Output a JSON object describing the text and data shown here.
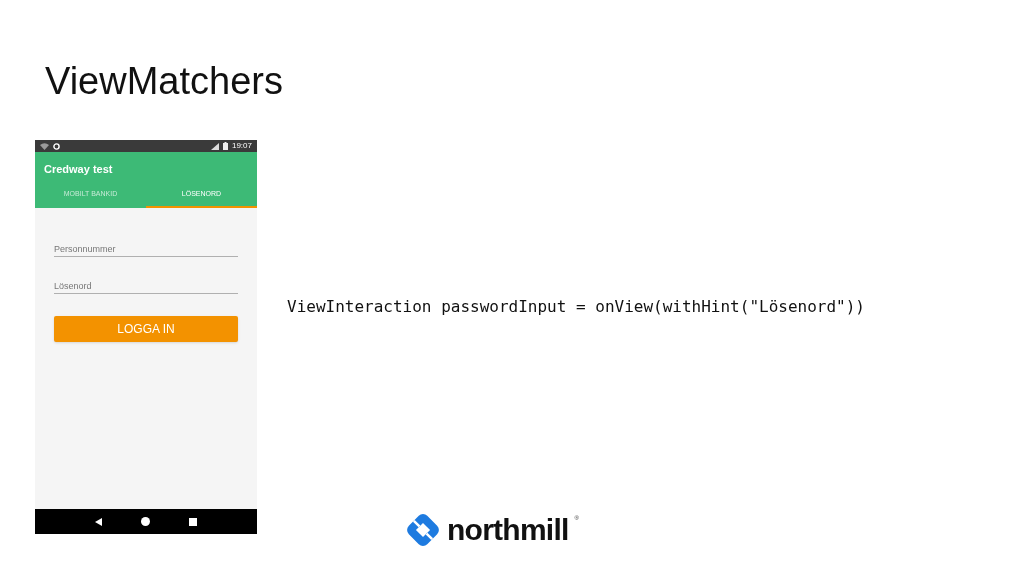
{
  "slide_title": "ViewMatchers",
  "phone": {
    "status_bar": {
      "time": "19:07"
    },
    "app_bar": {
      "title": "Credway test"
    },
    "tabs": [
      {
        "label": "MOBILT BANKID",
        "selected": false
      },
      {
        "label": "LÖSENORD",
        "selected": true
      }
    ],
    "fields": [
      {
        "placeholder": "Personnummer"
      },
      {
        "placeholder": "Lösenord"
      }
    ],
    "button": "LOGGA IN"
  },
  "code": "ViewInteraction passwordInput = onView(withHint(\"Lösenord\"))",
  "logo": {
    "name": "northmill",
    "mark": "®"
  }
}
